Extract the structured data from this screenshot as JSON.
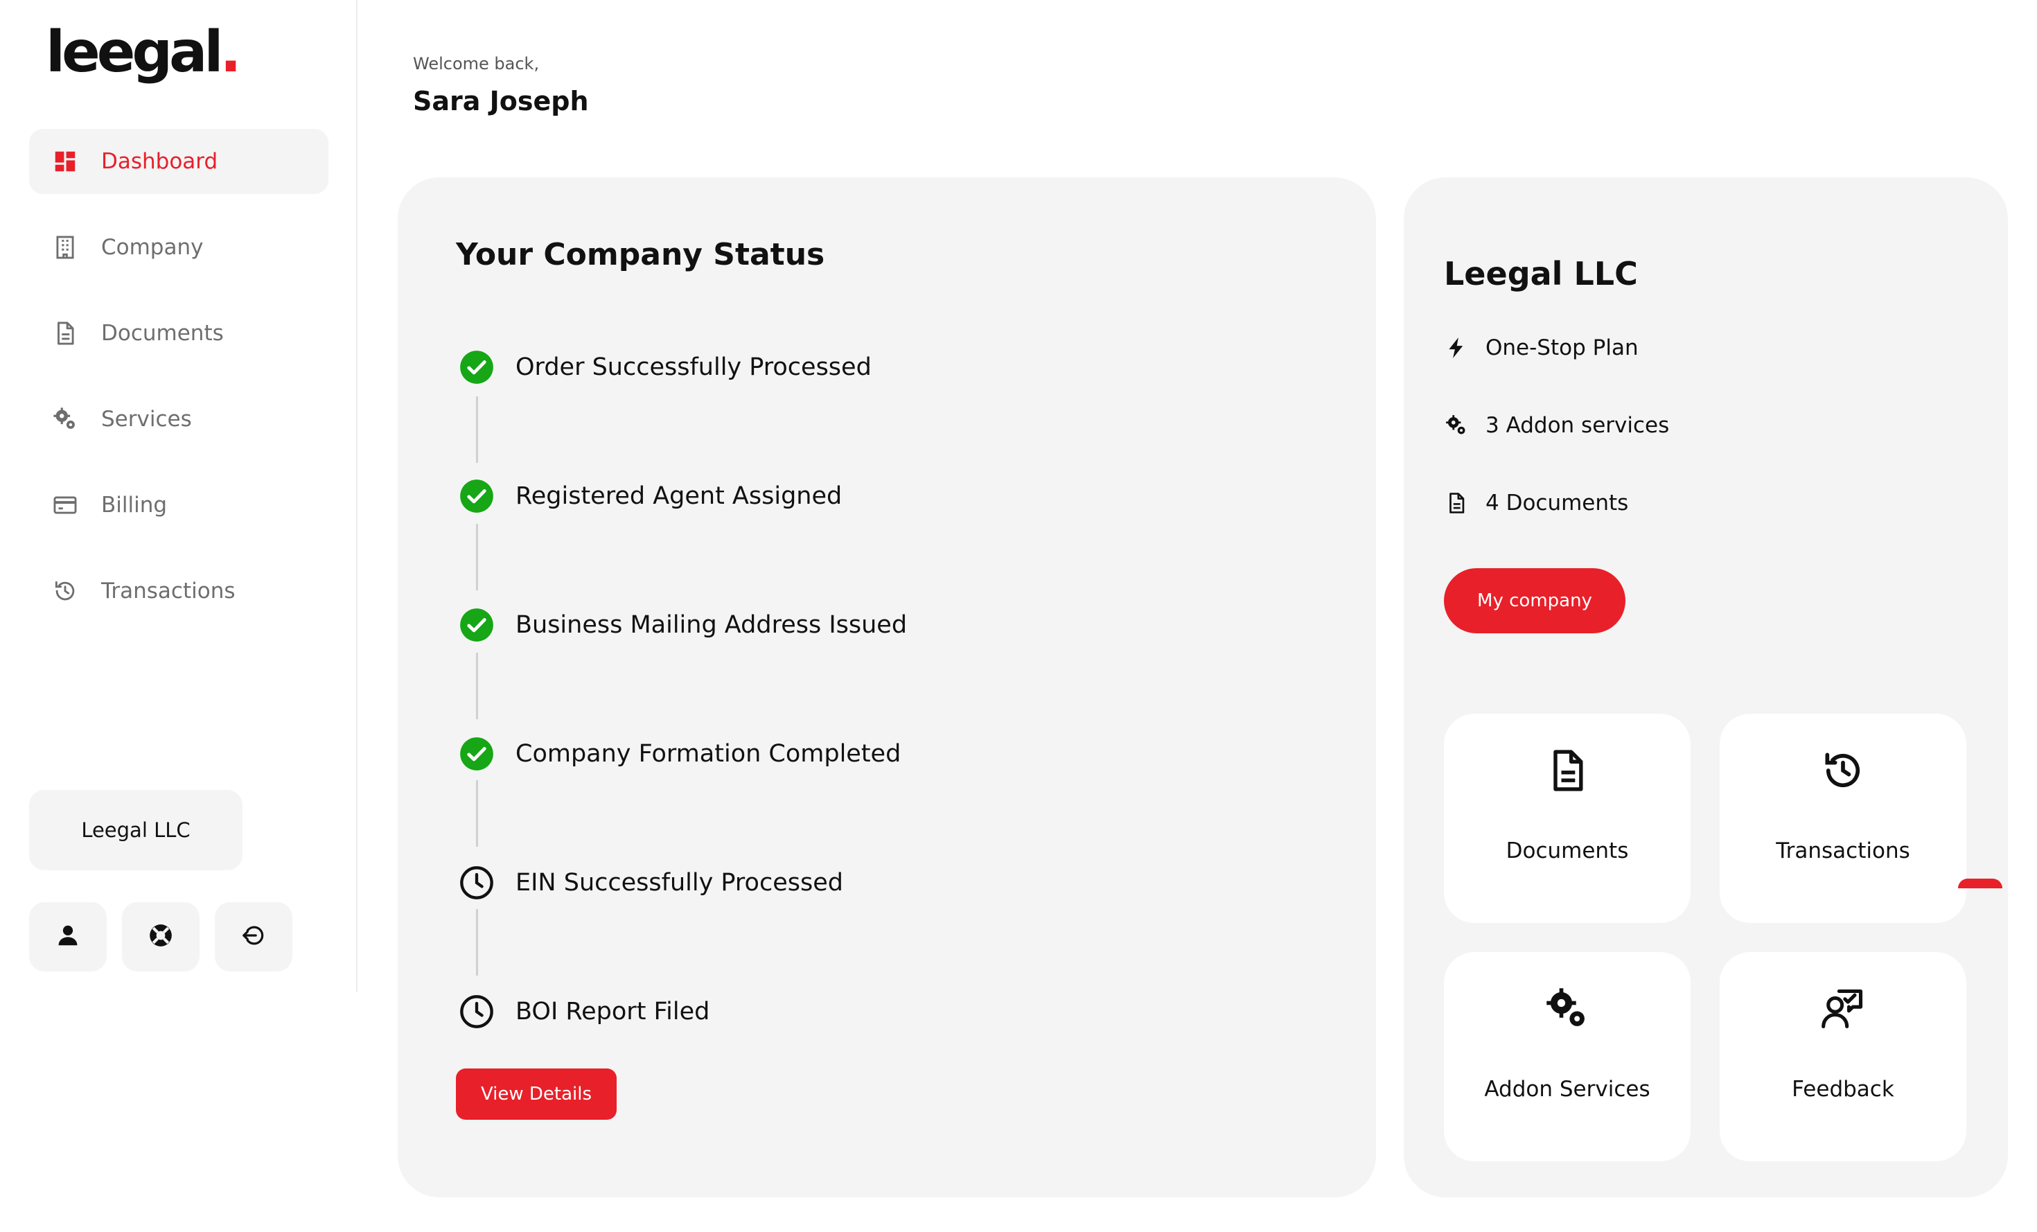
{
  "brand": {
    "name": "leegal",
    "dot": ".",
    "accent": "#e8202a"
  },
  "sidebar": {
    "items": [
      {
        "label": "Dashboard",
        "icon": "dashboard-icon",
        "active": true
      },
      {
        "label": "Company",
        "icon": "building-icon",
        "active": false
      },
      {
        "label": "Documents",
        "icon": "document-icon",
        "active": false
      },
      {
        "label": "Services",
        "icon": "gears-icon",
        "active": false
      },
      {
        "label": "Billing",
        "icon": "credit-card-icon",
        "active": false
      },
      {
        "label": "Transactions",
        "icon": "history-icon",
        "active": false
      }
    ],
    "company_selector": "Leegal LLC",
    "bottom_icons": [
      "user-icon",
      "help-lifebuoy-icon",
      "logout-icon"
    ]
  },
  "header": {
    "welcome": "Welcome back,",
    "user_name": "Sara Joseph"
  },
  "status": {
    "title": "Your Company Status",
    "steps": [
      {
        "label": "Order Successfully Processed",
        "state": "complete"
      },
      {
        "label": "Registered Agent Assigned",
        "state": "complete"
      },
      {
        "label": "Business Mailing Address Issued",
        "state": "complete"
      },
      {
        "label": "Company Formation Completed",
        "state": "complete"
      },
      {
        "label": "EIN Successfully Processed",
        "state": "pending"
      },
      {
        "label": "BOI Report Filed",
        "state": "pending"
      }
    ],
    "view_button": "View Details"
  },
  "company_card": {
    "name": "Leegal LLC",
    "details": [
      {
        "icon": "bolt-icon",
        "text": "One-Stop Plan"
      },
      {
        "icon": "gears-icon",
        "text": "3 Addon services"
      },
      {
        "icon": "document-icon",
        "text": "4 Documents"
      }
    ],
    "button": "My company",
    "tiles": [
      {
        "label": "Documents",
        "icon": "document-icon"
      },
      {
        "label": "Transactions",
        "icon": "history-icon"
      },
      {
        "label": "Addon Services",
        "icon": "gears-icon"
      },
      {
        "label": "Feedback",
        "icon": "feedback-icon"
      }
    ]
  },
  "colors": {
    "accent": "#e8202a",
    "success": "#16a616",
    "card_bg": "#f4f4f4",
    "muted_text": "#6e6e6e"
  }
}
